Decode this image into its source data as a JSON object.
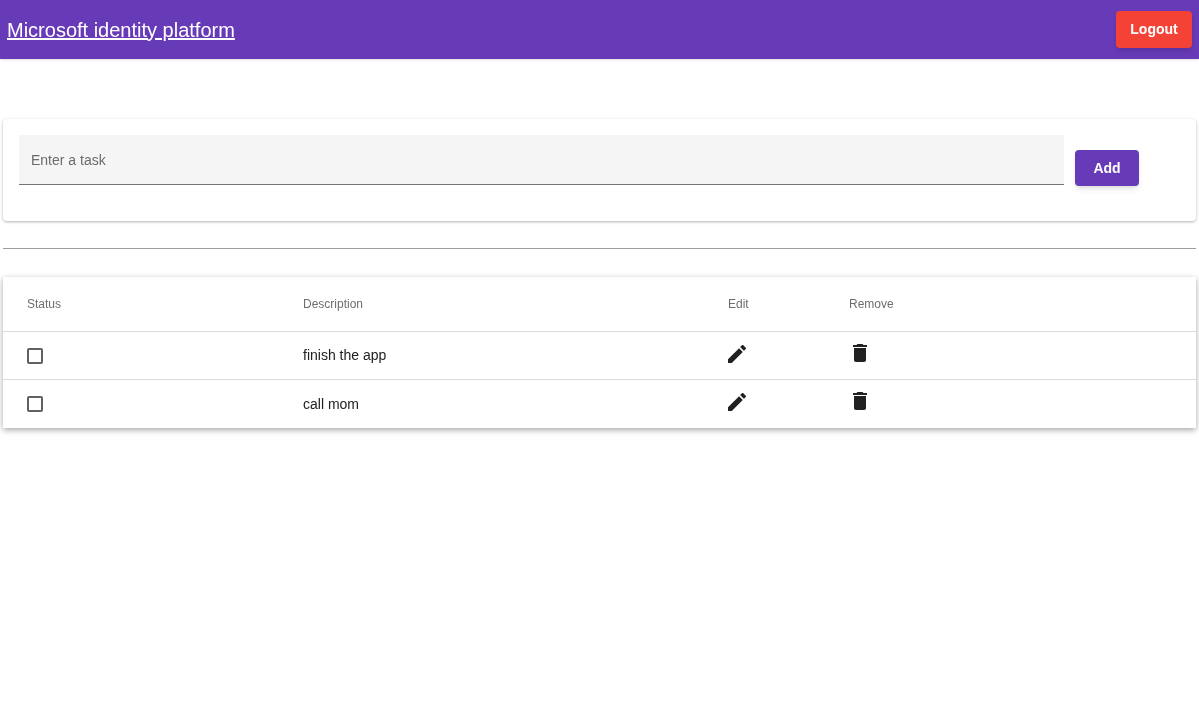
{
  "header": {
    "title": "Microsoft identity platform",
    "logout": "Logout"
  },
  "task_form": {
    "placeholder": "Enter a task",
    "add": "Add"
  },
  "table": {
    "columns": [
      "Status",
      "Description",
      "Edit",
      "Remove"
    ],
    "rows": [
      {
        "checked": false,
        "description": "finish the app"
      },
      {
        "checked": false,
        "description": "call mom"
      }
    ]
  }
}
